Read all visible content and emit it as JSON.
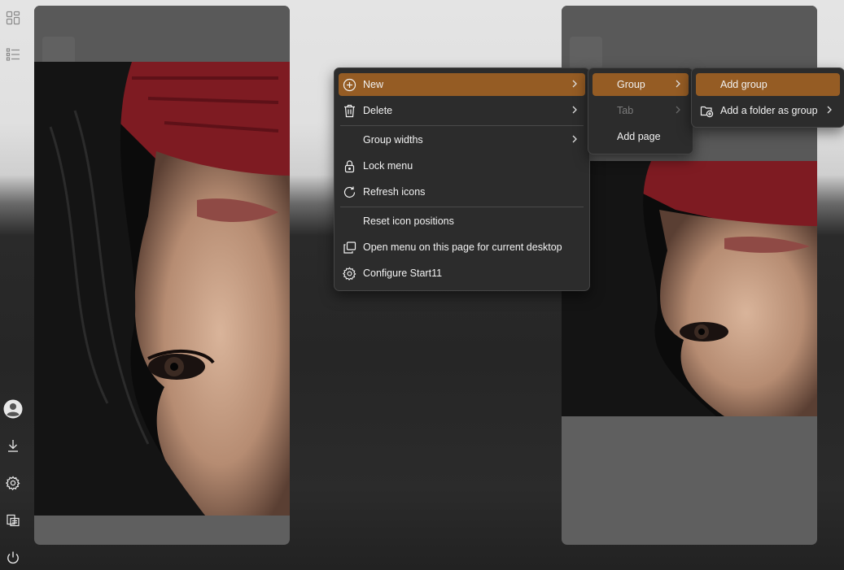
{
  "rail": {
    "items": [
      {
        "name": "all-apps-icon"
      },
      {
        "name": "list-view-icon"
      },
      {
        "name": "user-avatar-icon"
      },
      {
        "name": "downloads-icon"
      },
      {
        "name": "settings-icon"
      },
      {
        "name": "file-explorer-icon"
      },
      {
        "name": "power-icon"
      }
    ]
  },
  "context_menu": {
    "items": [
      {
        "label": "New",
        "icon": "plus-circle-icon",
        "submenu": true,
        "highlighted": true
      },
      {
        "label": "Delete",
        "icon": "trash-icon",
        "submenu": true
      },
      {
        "label": "Group widths",
        "icon": "",
        "submenu": true
      },
      {
        "label": "Lock menu",
        "icon": "lock-icon",
        "submenu": false
      },
      {
        "label": "Refresh icons",
        "icon": "refresh-icon",
        "submenu": false
      },
      {
        "label": "Reset icon positions",
        "icon": "",
        "submenu": false
      },
      {
        "label": "Open menu on this page for current desktop",
        "icon": "copy-window-icon",
        "submenu": false
      },
      {
        "label": "Configure Start11",
        "icon": "gear-icon",
        "submenu": false
      }
    ]
  },
  "new_submenu": {
    "items": [
      {
        "label": "Group",
        "submenu": true,
        "highlighted": true
      },
      {
        "label": "Tab",
        "submenu": true,
        "disabled": true
      },
      {
        "label": "Add page",
        "submenu": false
      }
    ]
  },
  "group_submenu": {
    "items": [
      {
        "label": "Add group",
        "highlighted": true
      },
      {
        "label": "Add a folder as group",
        "icon": "folder-add-icon",
        "submenu": true
      }
    ]
  },
  "colors": {
    "highlight": "#955c24",
    "menu_bg": "#2c2c2c",
    "panel_bg": "#5f5f5f"
  }
}
